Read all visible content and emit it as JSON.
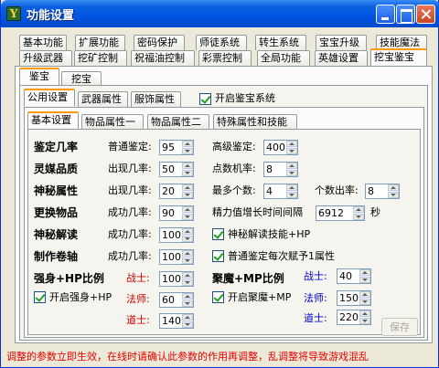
{
  "window": {
    "title": "功能设置",
    "icon": "app-icon"
  },
  "tabs_row1": [
    "基本功能",
    "扩展功能",
    "密码保护",
    "师徒系统",
    "转生系统",
    "宝宝升级",
    "技能魔法"
  ],
  "tabs_row2": [
    "升级武器",
    "挖矿控制",
    "祝福油控制",
    "彩票控制",
    "全局功能",
    "英雄设置",
    "挖宝鉴宝"
  ],
  "subtabs": [
    "鉴宝",
    "挖宝"
  ],
  "subtabs2": [
    "公用设置",
    "武器属性",
    "服饰属性"
  ],
  "enable_identify": {
    "label": "开启鉴宝系统",
    "checked": true
  },
  "subtabs3": [
    "基本设置",
    "物品属性一",
    "物品属性二",
    "特殊属性和技能"
  ],
  "rows": {
    "identify_rate": {
      "title": "鉴定几率",
      "normal_label": "普通鉴定:",
      "normal_value": "95",
      "advanced_label": "高级鉴定:",
      "advanced_value": "400"
    },
    "spirit_quality": {
      "title": "灵媒品质",
      "appear_label": "出现几率:",
      "appear_value": "50",
      "points_label": "点数机率:",
      "points_value": "8"
    },
    "mystic_attr": {
      "title": "神秘属性",
      "appear_label": "出现几率:",
      "appear_value": "20",
      "max_label": "最多个数:",
      "max_value": "4",
      "count_label": "个数出率:",
      "count_value": "8"
    },
    "change_item": {
      "title": "更换物品",
      "success_label": "成功几率:",
      "success_value": "90",
      "interval_label": "精力值增长时间间隔",
      "interval_value": "6912",
      "unit": "秒"
    },
    "mystic_decode": {
      "title": "神秘解读",
      "success_label": "成功几率:",
      "success_value": "100",
      "checkbox_label": "神秘解读技能+HP",
      "checked": true
    },
    "make_scroll": {
      "title": "制作卷轴",
      "success_label": "成功几率:",
      "success_value": "100",
      "checkbox_label": "普通鉴定每次赋予1属性",
      "checked": true
    }
  },
  "strong": {
    "title": "强身+HP比例",
    "checkbox_label": "开启强身+HP",
    "checked": true,
    "warrior_label": "战士:",
    "warrior_value": "100",
    "mage_label": "法师:",
    "mage_value": "60",
    "taoist_label": "道士:",
    "taoist_value": "140"
  },
  "gather": {
    "title": "聚魔+MP比例",
    "checkbox_label": "开启聚魔+MP",
    "checked": true,
    "warrior_label": "战士:",
    "warrior_value": "40",
    "mage_label": "法师:",
    "mage_value": "150",
    "taoist_label": "道士:",
    "taoist_value": "220"
  },
  "save_label": "保存",
  "status_text": "调整的参数立即生效，在线时请确认此参数的作用再调整，乱调整将导致游戏混乱",
  "colors": {
    "title_bar": "#0054e3",
    "status_text": "#e30000",
    "strong_labels": "#cc0000",
    "gather_labels": "#0000cc"
  }
}
